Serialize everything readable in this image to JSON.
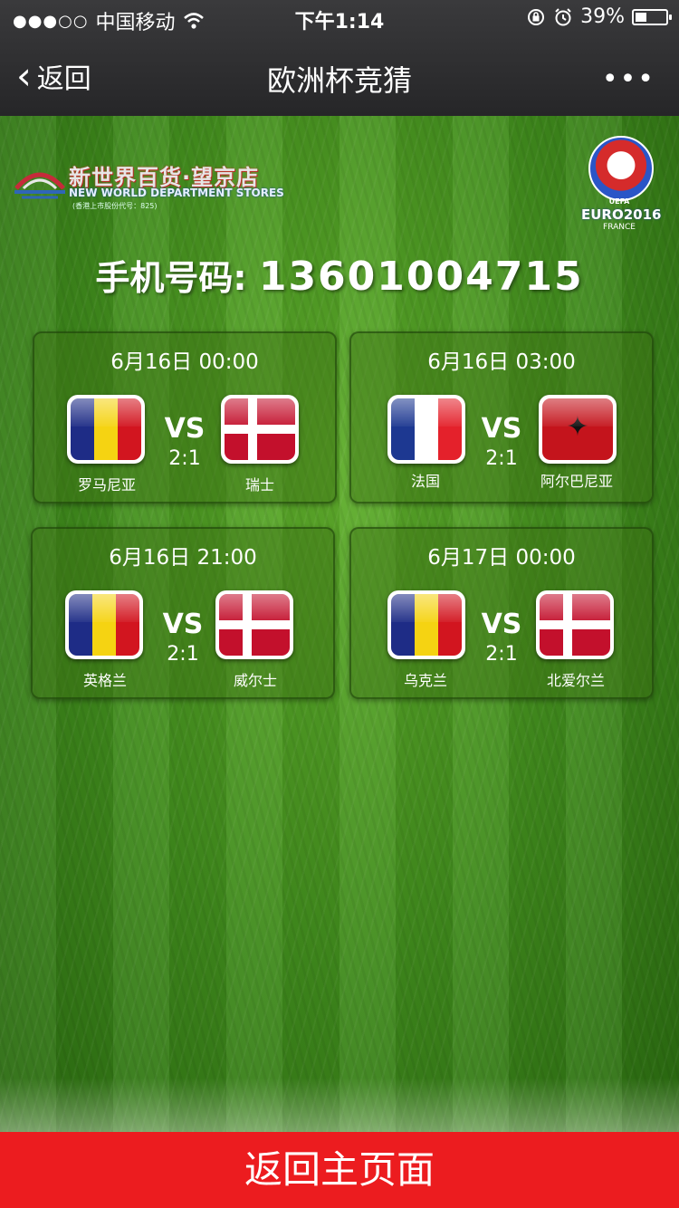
{
  "status_bar": {
    "signal_dots": "●●●○○",
    "carrier": "中国移动",
    "time": "下午1:14",
    "battery": "39%",
    "battery_level": 0.39
  },
  "nav": {
    "back_label": "返回",
    "title": "欧洲杯竞猜",
    "more_label": "•••"
  },
  "logo": {
    "name_cn": "新世界百货·望京店",
    "name_en": "NEW WORLD DEPARTMENT STORES",
    "note": "(香港上市股份代号：825)"
  },
  "euro_badge": {
    "uefa": "UEFA",
    "euro": "EURO2016",
    "country": "FRANCE"
  },
  "phone": {
    "label": "手机号码:",
    "number": "13601004715"
  },
  "vs_label": "VS",
  "matches": [
    {
      "time": "6月16日 00:00",
      "home": "罗马尼亚",
      "away": "瑞士",
      "score": "2:1",
      "home_flag": "romania-flag",
      "away_flag": "denmark-flag"
    },
    {
      "time": "6月16日 03:00",
      "home": "法国",
      "away": "阿尔巴尼亚",
      "score": "2:1",
      "home_flag": "france-flag",
      "away_flag": "albania-flag"
    },
    {
      "time": "6月16日 21:00",
      "home": "英格兰",
      "away": "威尔士",
      "score": "2:1",
      "home_flag": "romania-flag",
      "away_flag": "denmark-flag"
    },
    {
      "time": "6月17日 00:00",
      "home": "乌克兰",
      "away": "北爱尔兰",
      "score": "2:1",
      "home_flag": "romania-flag",
      "away_flag": "denmark-flag"
    }
  ],
  "footer": {
    "button_label": "返回主页面"
  },
  "colors": {
    "footer_red": "#ec1c1f",
    "grass_green": "#3f8a1c",
    "nav_dark": "#2f2f31"
  }
}
